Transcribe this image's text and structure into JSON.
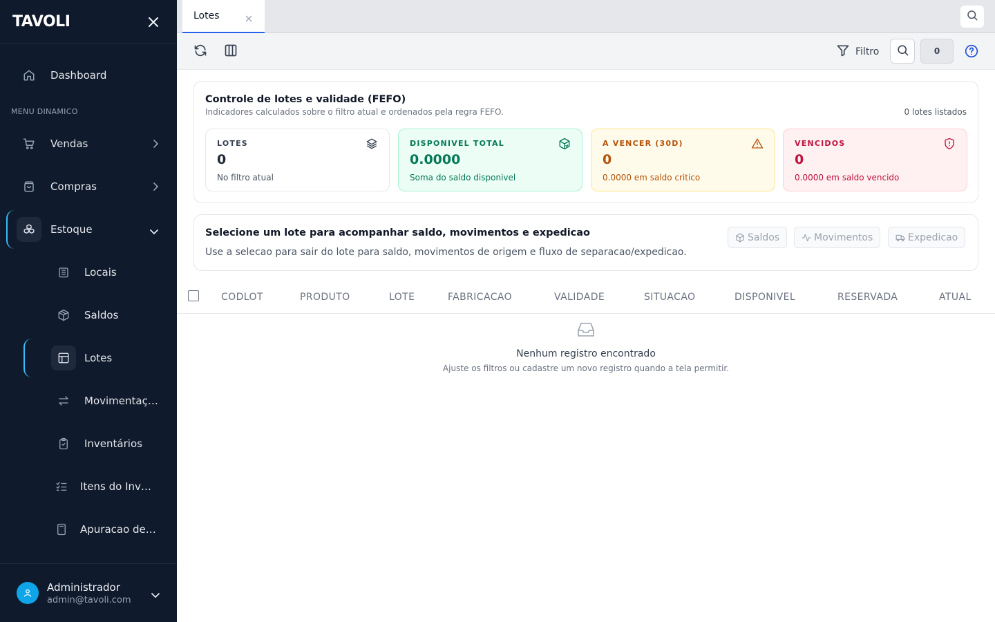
{
  "brand": {
    "logo": "TAVOLI"
  },
  "sidebar": {
    "section_label": "MENU DINAMICO",
    "items": [
      {
        "label": "Dashboard"
      },
      {
        "label": "Vendas"
      },
      {
        "label": "Compras"
      },
      {
        "label": "Estoque"
      }
    ],
    "sub_items": [
      {
        "label": "Locais"
      },
      {
        "label": "Saldos"
      },
      {
        "label": "Lotes"
      },
      {
        "label": "Movimentações"
      },
      {
        "label": "Inventários"
      },
      {
        "label": "Itens do Inventário"
      },
      {
        "label": "Apuracao de Custos"
      }
    ],
    "user": {
      "name": "Administrador",
      "email": "admin@tavoli.com"
    }
  },
  "tabs": [
    {
      "label": "Lotes"
    }
  ],
  "toolbar": {
    "filter_label": "Filtro",
    "count": "0"
  },
  "summary": {
    "title": "Controle de lotes e validade (FEFO)",
    "subtitle": "Indicadores calculados sobre o filtro atual e ordenados pela regra FEFO.",
    "count_text": "0 lotes listados",
    "kpis": [
      {
        "label": "LOTES",
        "value": "0",
        "sub": "No filtro atual",
        "icon": "layers-icon"
      },
      {
        "label": "DISPONIVEL TOTAL",
        "value": "0.0000",
        "sub": "Soma do saldo disponivel",
        "icon": "package-check-icon"
      },
      {
        "label": "A VENCER (30D)",
        "value": "0",
        "sub": "0.0000 em saldo critico",
        "icon": "warning-icon"
      },
      {
        "label": "VENCIDOS",
        "value": "0",
        "sub": "0.0000 em saldo vencido",
        "icon": "shield-alert-icon"
      }
    ]
  },
  "selection": {
    "title": "Selecione um lote para acompanhar saldo, movimentos e expedicao",
    "subtitle": "Use a selecao para sair do lote para saldo, movimentos de origem e fluxo de separacao/expedicao.",
    "actions": [
      {
        "label": "Saldos"
      },
      {
        "label": "Movimentos"
      },
      {
        "label": "Expedicao"
      }
    ]
  },
  "table": {
    "columns": [
      "CODLOT",
      "PRODUTO",
      "LOTE",
      "FABRICACAO",
      "VALIDADE",
      "SITUACAO",
      "DISPONIVEL",
      "RESERVADA",
      "ATUAL"
    ],
    "rows": []
  },
  "empty": {
    "title": "Nenhum registro encontrado",
    "subtitle": "Ajuste os filtros ou cadastre um novo registro quando a tela permitir."
  },
  "colors": {
    "sidebar_bg": "#0f1a2c",
    "accent": "#38bdf8",
    "active_tab": "#2563eb",
    "green": "#047857",
    "amber": "#b45309",
    "red": "#be123c"
  }
}
